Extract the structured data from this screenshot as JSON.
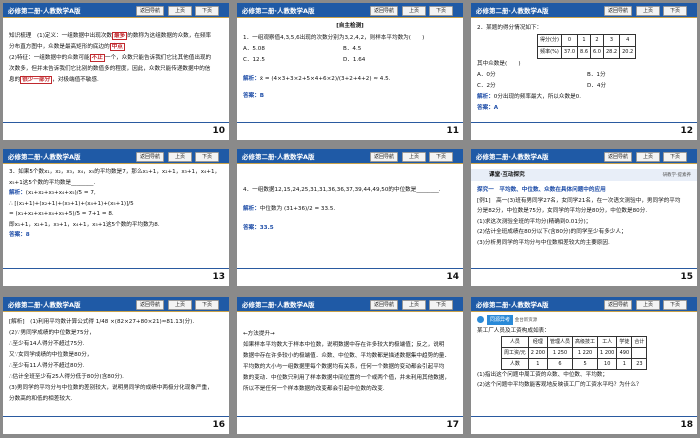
{
  "common": {
    "header_title": "必修第二册·人教数学A版",
    "nav_label": "返回导航",
    "prev_label": "上页",
    "next_label": "下页"
  },
  "slides": [
    {
      "number": "10",
      "l1a": "知识梳理　(1)定义：一组数据中出现次数",
      "l1b": "最多",
      "l1c": "的数称为这组数据的众数，在频率",
      "l2": "分布直方图中，众数是最高矩形的底边的",
      "l2b": "中点",
      "l3a": "(2)特征：一组数据中的众数可能",
      "l3b": "不止",
      "l3c": "一个，众数只能告诉我们它比其他值出现的",
      "l4": "次数多，但并未告诉我们它比别的数值多的程度，因此，众数只能传递数据中的信",
      "l5a": "息的",
      "l5b": "很少一部分",
      "l5c": "，对极端值不敏感."
    },
    {
      "number": "11",
      "section": "[自主检测]",
      "q": "1．一组观察值4,3,5,6出现的次数分别为3,2,4,2，则样本平均数为(　　)",
      "oa": "A．5.08",
      "ob": "B．4.5",
      "oc": "C．12.5",
      "od": "D．1.64",
      "ans_label": "解析：",
      "formula": "x̄ = (4×3+3×2+5×4+6×2)/(3+2+4+2) ≈ 4.5.",
      "answer": "答案：B"
    },
    {
      "number": "12",
      "q": "2．某题的得分情况如下：",
      "row1": [
        "得分(分)",
        "0",
        "1",
        "2",
        "3",
        "4"
      ],
      "row2": [
        "频率(%)",
        "37.0",
        "8.6",
        "6.0",
        "28.2",
        "20.2"
      ],
      "q2": "其中众数是(　　)",
      "oa": "A．0分",
      "ob": "B．1分",
      "oc": "C．2分",
      "od": "D．4分",
      "ans_label": "解析：",
      "ans": "0分出现的频率最大，所以众数是0.",
      "answer": "答案：A"
    },
    {
      "number": "13",
      "q1": "3．如果5个数x₁，x₂，x₃，x₄，x₅的平均数是7，那么x₁+1，x₂+1，x₃+1，x₄+1，",
      "q2": "x₅+1这5个数的平均数是________.",
      "ans_label": "解析：",
      "f1": "(x₁+x₂+x₃+x₄+x₅)/5 = 7,",
      "f2": "∴ [(x₁+1)+(x₂+1)+(x₃+1)+(x₄+1)+(x₅+1)]/5",
      "f3": "= (x₁+x₂+x₃+x₄+x₅+5)/5 = 7+1 = 8.",
      "f4": "即x₁+1，x₂+1，x₃+1，x₄+1，x₅+1这5个数的平均数为8.",
      "answer": "答案：8"
    },
    {
      "number": "14",
      "q": "4．一组数据12,15,24,25,31,31,36,36,37,39,44,49,50的中位数是________.",
      "ans_label": "解析：",
      "ans": "中位数为 (31+36)/2 = 33.5.",
      "answer": "答案：33.5"
    },
    {
      "number": "15",
      "section": "课堂·互动探究",
      "right": "研教学·提素养",
      "t1": "探究一　平均数、中位数、众数在具体问题中的应用",
      "l1": "[例1]　高一(3)班有男同学27名，女同学21名，在一次语文测验中，男同学的平均",
      "l2": "分是82分，中位数是75分，女同学的平均分是80分，中位数是80分.",
      "l3": "(1)求这次测验全班的平均分(精确到0.01分)；",
      "l4": "(2)估计全班成绩在80分以下(含80分)的同学至少有多少人；",
      "l5": "(3)分析男同学的平均分与中位数相差较大的主要原因."
    },
    {
      "number": "16",
      "l1": "[解析]　(1)利用平均数计算公式得 1/48 ×(82×27+80×21)≈81.13(分).",
      "l2": "(2)∵男同学成绩的中位数是75分，",
      "l3": "∴至少有14人得分不超过75分.",
      "l4": "又∵女同学成绩的中位数是80分，",
      "l5": "∴至少有11人得分不超过80分.",
      "l6": "∴估计全班至少有25人得分低于80分(含80分).",
      "l7": "(3)男同学的平均分与中位数的差别较大，说明男同学的成绩中两极分化现象严重，",
      "l8": "分数高的和低的相差较大."
    },
    {
      "number": "17",
      "title": "←方法提升→",
      "p1": "如果样本平均数大于样本中位数，说明数据中存在许多较大的极端值；反之，说明",
      "p2": "数据中存在许多较小的极端值．众数、中位数、平均数都是描述数据集中趋势的量．",
      "p3": "平均数的大小与一组数据里每个数据均有关系，任何一个数据的变动都会引起平均",
      "p4": "数的变动．中位数只利用了样本数据中间位置的一个或两个值，并未利用其他数据，",
      "p5": "所以不是任何一个样本数据的改变都会引起中位数的改变."
    },
    {
      "number": "18",
      "tag": "同源异考",
      "tag2": "金台新资源",
      "intro": "某工厂人员及工资构成如表：",
      "head": [
        "人员",
        "经理",
        "管理人员",
        "高级技工",
        "工人",
        "学徒",
        "合计"
      ],
      "r1": [
        "周工资/元",
        "2 200",
        "1 250",
        "1 220",
        "1 200",
        "490",
        ""
      ],
      "r2": [
        "人数",
        "1",
        "6",
        "5",
        "10",
        "1",
        "23"
      ],
      "q1": "(1)指出这个问题中周工资的众数、中位数、平均数；",
      "q2": "(2)这个问题中平均数能客观地反映该工厂的工资水平吗？为什么？"
    }
  ]
}
